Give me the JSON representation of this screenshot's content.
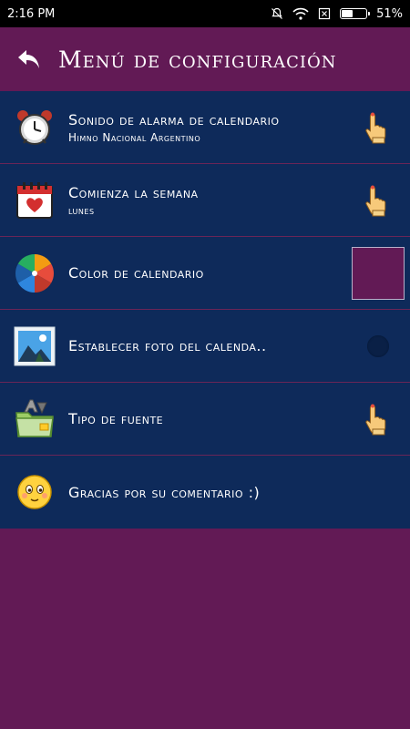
{
  "status": {
    "time": "2:16 PM",
    "battery": "51%",
    "battery_level": 0.51
  },
  "header": {
    "title": "Menú de configuración",
    "back_icon": "back-arrow-icon"
  },
  "settings": [
    {
      "title": "Sonido de alarma de calendario",
      "subtitle": "Himno Nacional Argentino",
      "icon": "alarm-clock-icon",
      "action": "hand-pointer-icon"
    },
    {
      "title": "Comienza la semana",
      "subtitle": "lunes",
      "icon": "calendar-heart-icon",
      "action": "hand-pointer-icon"
    },
    {
      "title": "Color de calendario",
      "icon": "color-wheel-icon",
      "swatch_color": "#621a55"
    },
    {
      "title": "Establecer foto del calenda..",
      "icon": "photo-icon",
      "action": "toggle-off"
    },
    {
      "title": "Tipo de fuente",
      "icon": "font-folder-icon",
      "action": "hand-pointer-icon"
    },
    {
      "title": "Gracias por su comentario :)",
      "icon": "smiley-icon"
    }
  ],
  "colors": {
    "primary": "#621a55",
    "list_bg": "#0e2a5a"
  }
}
